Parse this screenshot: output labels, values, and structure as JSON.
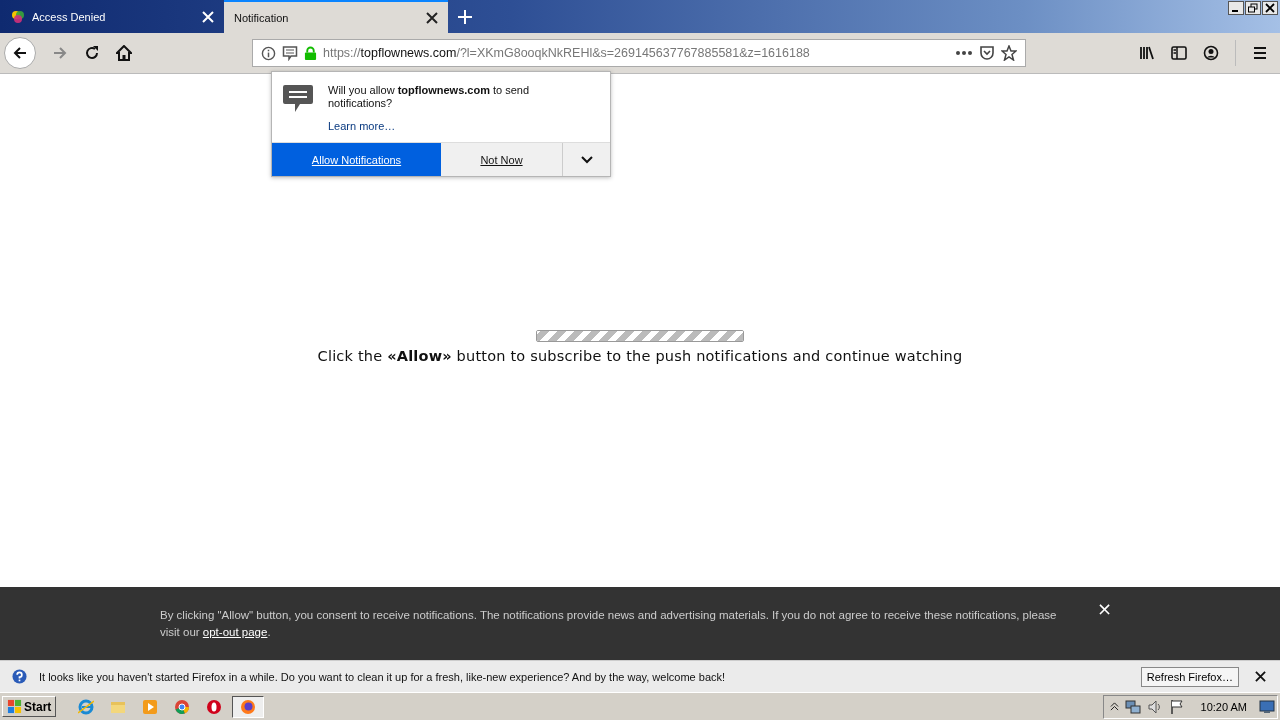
{
  "tabs": [
    {
      "title": "Access Denied",
      "selected": false,
      "kind": "site"
    },
    {
      "title": "Notification",
      "selected": true,
      "kind": "plain"
    }
  ],
  "url": {
    "prefix": "https://",
    "domain": "topflownews.com",
    "rest": "/?l=XKmG8ooqkNkREHl&s=269145637767885581&z=1616188"
  },
  "popup": {
    "message": "Will you allow **topflownews.com** to send notifications?",
    "link": "Learn more…",
    "allow": "Allow Notifications",
    "deny": "Not Now"
  },
  "page": {
    "progress": {
      "level": 1
    },
    "message": "Click the **«Allow»** button to subscribe to the push notifications and continue watching"
  },
  "consent": {
    "text": "By clicking \"Allow\" button, you consent to receive notifications. The notifications provide news and advertising materials. If you do not agree to receive these notifications, please visit our",
    "link": "opt-out page",
    "end": ".",
    "close": "×"
  },
  "notice": {
    "text": "It looks like you haven't started Firefox in a while. Do you want to clean it up for a fresh, like-new experience? And by the way, welcome back!",
    "button": "Refresh Firefox…"
  },
  "taskbar": {
    "start": "Start",
    "apps": [
      {
        "kind": "ie",
        "selected": false
      },
      {
        "kind": "folder",
        "selected": false
      },
      {
        "kind": "media",
        "selected": false
      },
      {
        "kind": "chrome",
        "selected": false
      },
      {
        "kind": "opera",
        "selected": false
      },
      {
        "kind": "firefox",
        "selected": true
      }
    ],
    "time": "10:20 AM"
  }
}
